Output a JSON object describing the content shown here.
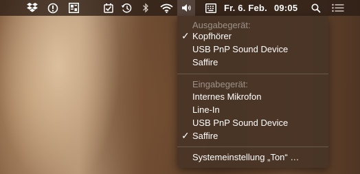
{
  "menubar": {
    "date": "Fr. 6. Feb.",
    "time": "09:05",
    "icons": [
      "dropbox-icon",
      "status-alert-icon",
      "app-grid-icon",
      "checkmark-clock-icon",
      "time-machine-icon",
      "bluetooth-icon",
      "wifi-icon",
      "volume-icon",
      "keyboard-icon",
      "search-icon",
      "notification-list-icon"
    ]
  },
  "sound_menu": {
    "output_header": "Ausgabegerät:",
    "output_devices": [
      {
        "label": "Kopfhörer",
        "selected": true
      },
      {
        "label": "USB PnP Sound Device",
        "selected": false
      },
      {
        "label": "Saffire",
        "selected": false
      }
    ],
    "input_header": "Eingabegerät:",
    "input_devices": [
      {
        "label": "Internes Mikrofon",
        "selected": false
      },
      {
        "label": "Line-In",
        "selected": false
      },
      {
        "label": "USB PnP Sound Device",
        "selected": false
      },
      {
        "label": "Saffire",
        "selected": true
      }
    ],
    "check_glyph": "✓",
    "preferences_label": "Systemeinstellung „Ton“ …"
  },
  "colors": {
    "menubar_bg": "#2c1e16",
    "menu_bg": "#483426",
    "text": "#ffffff",
    "header_text": "#8f847c"
  }
}
